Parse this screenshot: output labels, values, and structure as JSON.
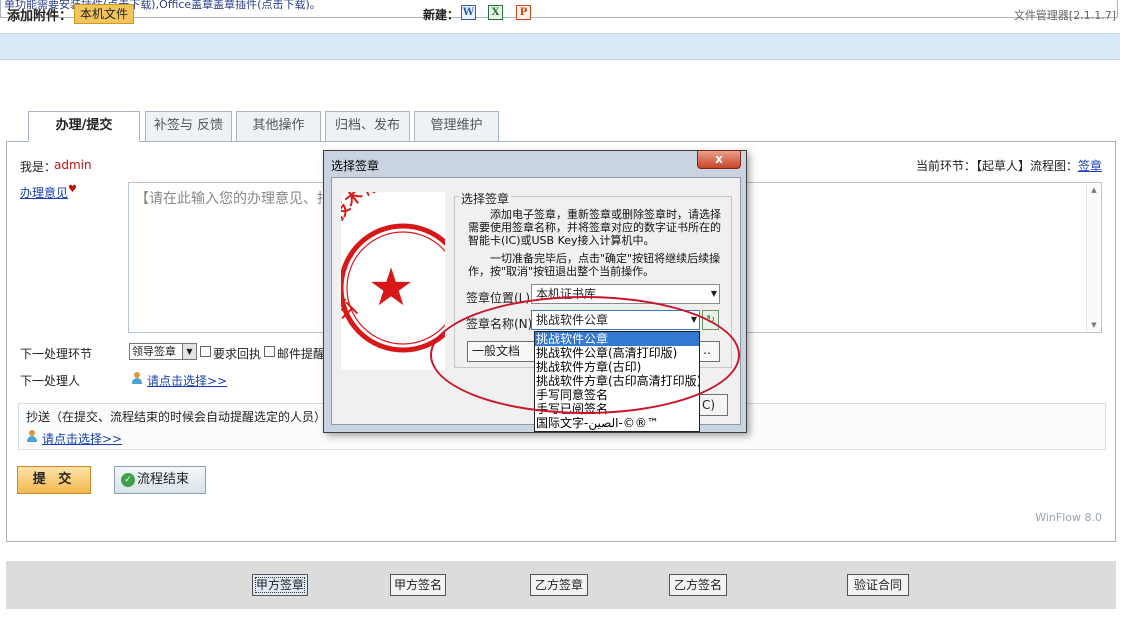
{
  "top_notice": "单功能需要安装插件(点击下载),Office盖章盖章插件(点击下载)。",
  "attachment_bar": {
    "label": "添加附件：",
    "local_file": "本机文件",
    "new_label": "新建：",
    "icons": [
      "word-icon",
      "excel-icon",
      "powerpoint-icon"
    ],
    "icon_glyphs": {
      "word": "W",
      "excel": "X",
      "ppt": "P"
    },
    "version": "文件管理器[2.1.1.7]"
  },
  "tabs": [
    {
      "label": "办理/提交",
      "active": true
    },
    {
      "label": "补签与 反馈",
      "active": false
    },
    {
      "label": "其他操作",
      "active": false
    },
    {
      "label": "归档、发布",
      "active": false
    },
    {
      "label": "管理维护",
      "active": false
    }
  ],
  "form": {
    "me_label": "我是：",
    "me_value": "admin",
    "current_step_prefix": "当前环节：【起草人】流程图：",
    "flow_link": "签章",
    "opinion_label": "办理意见",
    "opinion_mark": "♥",
    "opinion_placeholder": "【请在此输入您的办理意见、指示",
    "next_step_label": "下一处理环节",
    "next_step_value": "领导签章",
    "require_reply": "要求回执",
    "mail_remind": "邮件提醒",
    "next_handler_label": "下一处理人",
    "choose_link": "请点击选择>>",
    "cc_label": "抄送（在提交、流程结束的时候会自动提醒选定的人员）",
    "cc_link": "请点击选择>>",
    "submit": "提 交",
    "end_flow": "流程结束",
    "check_glyph": "✓",
    "footer_brand": "WinFlow 8.0"
  },
  "bottom_buttons": [
    "甲方签章",
    "甲方签名",
    "乙方签章",
    "乙方签名",
    "验证合同"
  ],
  "dialog": {
    "title": "选择签章",
    "close": "x",
    "group_title": "选择签章",
    "desc1": "添加电子签章，重新签章或删除签章时，请选择需要使用签章名称，并将签章对应的数字证书所在的智能卡(IC)或USB Key接入计算机中。",
    "desc2": "一切准备完毕后，点击\"确定\"按钮将继续后续操作，按\"取消\"按钮退出整个当前操作。",
    "location_label": "签章位置(L)",
    "location_value": "本机证书库",
    "name_label": "签章名称(N)",
    "name_value": "挑战软件公章",
    "doc_type": "一般文档",
    "more": "..",
    "cancel_tail": "C)",
    "refresh_glyph": "↻",
    "dropdown_arrow": "▼",
    "dropdown_options": [
      "挑战软件公章",
      "挑战软件公章(高清打印版)",
      "挑战软件方章(古印)",
      "挑战软件方章(古印高清打印版)",
      "手写同意签名",
      "手写已阅签名",
      "国际文字-الصين-©®™"
    ],
    "selected_option": 0,
    "seal": {
      "text": "上海挑战软件技术有限公司",
      "star": "★",
      "color": "#d81818"
    }
  },
  "colors": {
    "link": "#1a3fb0",
    "annotation_ellipse": "#c8162a",
    "selection": "#3378d2",
    "attach_bar": "#d7e8f6"
  }
}
